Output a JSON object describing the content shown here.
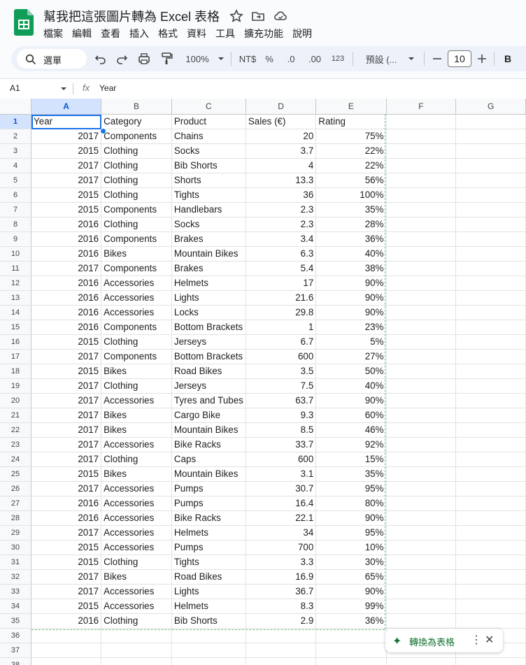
{
  "doc": {
    "title": "幫我把這張圖片轉為 Excel 表格"
  },
  "menu": [
    "檔案",
    "編輯",
    "查看",
    "插入",
    "格式",
    "資料",
    "工具",
    "擴充功能",
    "說明"
  ],
  "toolbar": {
    "search_label": "選單",
    "zoom": "100%",
    "currency": "NT$",
    "percent": "%",
    "dec_decrease": ".0",
    "dec_increase": ".00",
    "number_format": "123",
    "font": "預設 (...",
    "font_size": "10",
    "bold": "B"
  },
  "formula_bar": {
    "cell_ref": "A1",
    "fx": "fx",
    "value": "Year"
  },
  "columns": [
    "A",
    "B",
    "C",
    "D",
    "E",
    "F",
    "G"
  ],
  "rows": [
    [
      "Year",
      "Category",
      "Product",
      "Sales (€)",
      "Rating"
    ],
    [
      "2017",
      "Components",
      "Chains",
      "20",
      "75%"
    ],
    [
      "2015",
      "Clothing",
      "Socks",
      "3.7",
      "22%"
    ],
    [
      "2017",
      "Clothing",
      "Bib Shorts",
      "4",
      "22%"
    ],
    [
      "2017",
      "Clothing",
      "Shorts",
      "13.3",
      "56%"
    ],
    [
      "2015",
      "Clothing",
      "Tights",
      "36",
      "100%"
    ],
    [
      "2015",
      "Components",
      "Handlebars",
      "2.3",
      "35%"
    ],
    [
      "2016",
      "Clothing",
      "Socks",
      "2.3",
      "28%"
    ],
    [
      "2016",
      "Components",
      "Brakes",
      "3.4",
      "36%"
    ],
    [
      "2016",
      "Bikes",
      "Mountain Bikes",
      "6.3",
      "40%"
    ],
    [
      "2017",
      "Components",
      "Brakes",
      "5.4",
      "38%"
    ],
    [
      "2016",
      "Accessories",
      "Helmets",
      "17",
      "90%"
    ],
    [
      "2016",
      "Accessories",
      "Lights",
      "21.6",
      "90%"
    ],
    [
      "2016",
      "Accessories",
      "Locks",
      "29.8",
      "90%"
    ],
    [
      "2016",
      "Components",
      "Bottom Brackets",
      "1",
      "23%"
    ],
    [
      "2015",
      "Clothing",
      "Jerseys",
      "6.7",
      "5%"
    ],
    [
      "2017",
      "Components",
      "Bottom Brackets",
      "600",
      "27%"
    ],
    [
      "2015",
      "Bikes",
      "Road Bikes",
      "3.5",
      "50%"
    ],
    [
      "2017",
      "Clothing",
      "Jerseys",
      "7.5",
      "40%"
    ],
    [
      "2017",
      "Accessories",
      "Tyres and Tubes",
      "63.7",
      "90%"
    ],
    [
      "2017",
      "Bikes",
      "Cargo Bike",
      "9.3",
      "60%"
    ],
    [
      "2017",
      "Bikes",
      "Mountain Bikes",
      "8.5",
      "46%"
    ],
    [
      "2017",
      "Accessories",
      "Bike Racks",
      "33.7",
      "92%"
    ],
    [
      "2017",
      "Clothing",
      "Caps",
      "600",
      "15%"
    ],
    [
      "2015",
      "Bikes",
      "Mountain Bikes",
      "3.1",
      "35%"
    ],
    [
      "2017",
      "Accessories",
      "Pumps",
      "30.7",
      "95%"
    ],
    [
      "2016",
      "Accessories",
      "Pumps",
      "16.4",
      "80%"
    ],
    [
      "2016",
      "Accessories",
      "Bike Racks",
      "22.1",
      "90%"
    ],
    [
      "2017",
      "Accessories",
      "Helmets",
      "34",
      "95%"
    ],
    [
      "2015",
      "Accessories",
      "Pumps",
      "700",
      "10%"
    ],
    [
      "2015",
      "Clothing",
      "Tights",
      "3.3",
      "30%"
    ],
    [
      "2017",
      "Bikes",
      "Road Bikes",
      "16.9",
      "65%"
    ],
    [
      "2017",
      "Accessories",
      "Lights",
      "36.7",
      "90%"
    ],
    [
      "2015",
      "Accessories",
      "Helmets",
      "8.3",
      "99%"
    ],
    [
      "2016",
      "Clothing",
      "Bib Shorts",
      "2.9",
      "36%"
    ],
    [
      "",
      "",
      "",
      "",
      ""
    ],
    [
      "",
      "",
      "",
      "",
      ""
    ],
    [
      "",
      "",
      "",
      "",
      ""
    ]
  ],
  "convert_chip": {
    "label": "轉換為表格"
  },
  "colors": {
    "accent": "#0b57d0",
    "sheet_green": "#137333",
    "selection": "#1a73e8"
  }
}
